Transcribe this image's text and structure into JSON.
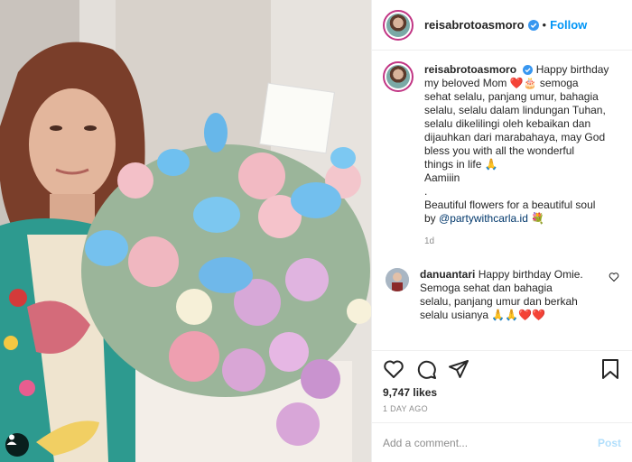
{
  "post": {
    "username": "reisabrotoasmoro",
    "follow_label": "Follow",
    "separator": "•",
    "caption_lines": [
      "Happy birthday",
      "my beloved Mom ❤️🎂 semoga",
      "sehat selalu, panjang umur, bahagia",
      "selalu, selalu dalam lindungan Tuhan,",
      "selalu dikelilingi oleh kebaikan dan",
      "dijauhkan dari marabahaya, may God",
      "bless you with all the wonderful",
      "things in life 🙏",
      "Aamiiin",
      ".",
      "Beautiful flowers for a beautiful soul",
      "by "
    ],
    "caption_mention": "@partywithcarla.id",
    "caption_end": " 💐",
    "caption_age": "1d",
    "comment": {
      "username": "danuantari",
      "lines": [
        "Happy birthday Omie.",
        "Semoga sehat dan bahagia",
        "selalu, panjang umur dan berkah",
        "selalu usianya 🙏🙏❤️❤️"
      ]
    },
    "likes": "9,747 likes",
    "time_ago": "1 DAY AGO",
    "add_comment_placeholder": "Add a comment...",
    "post_button": "Post"
  },
  "icons": {
    "like": "heart-icon",
    "comment": "comment-icon",
    "share": "paper-plane-icon",
    "save": "bookmark-icon",
    "verified": "verified-badge-icon",
    "tag": "user-tag-icon"
  },
  "colors": {
    "link": "#0095f6",
    "mention": "#00376b",
    "muted": "#8e8e8e",
    "post_disabled": "#b2dffc"
  }
}
